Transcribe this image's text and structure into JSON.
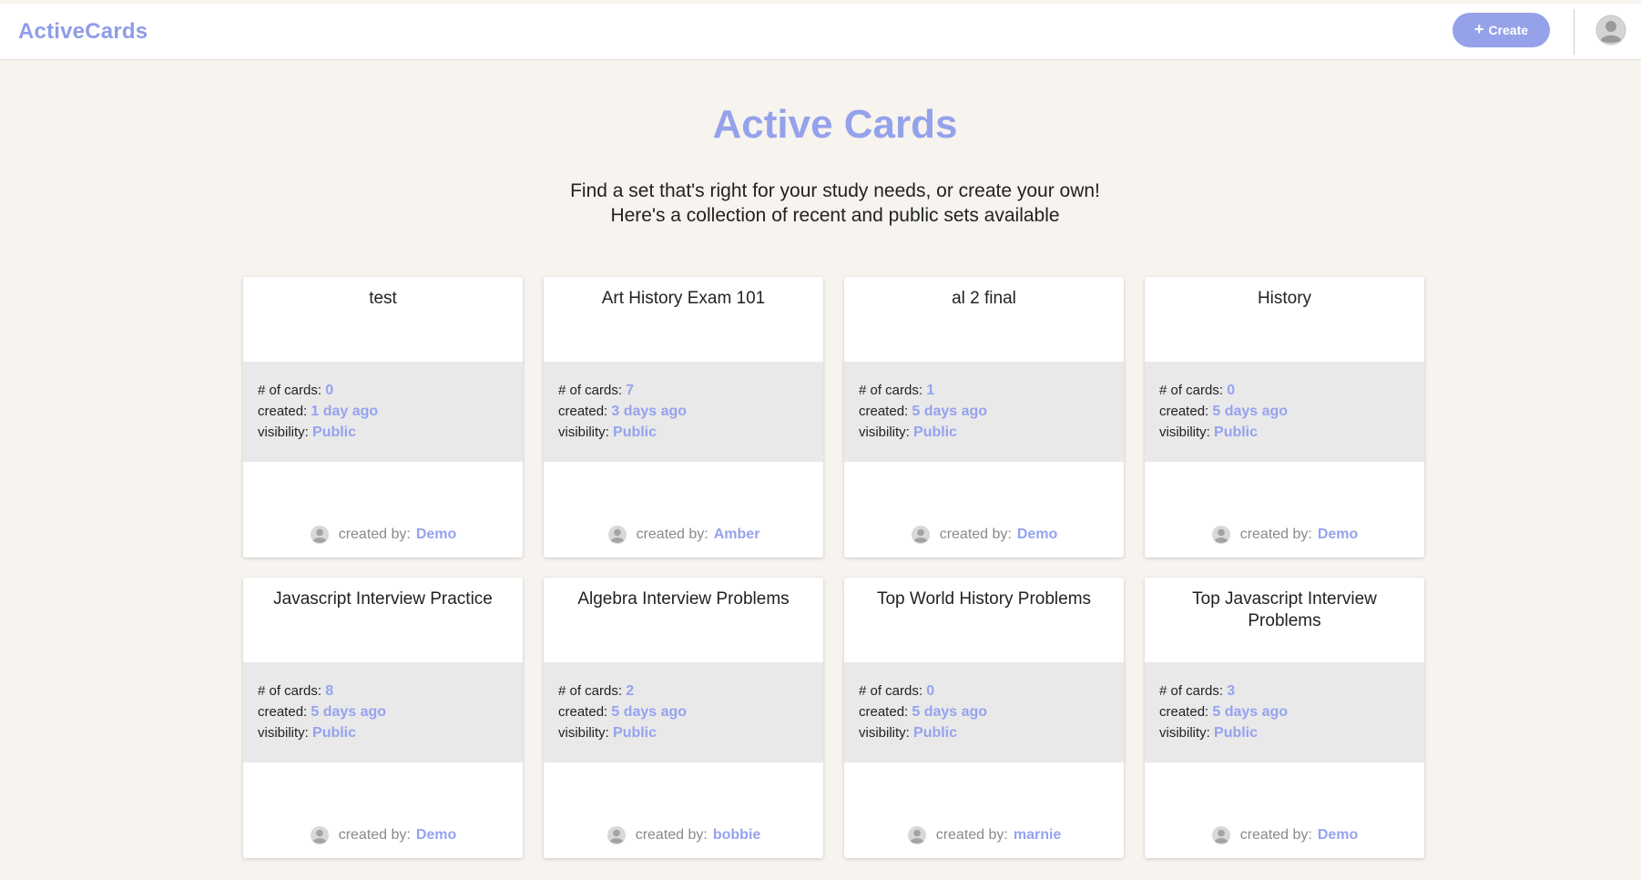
{
  "header": {
    "brand": "ActiveCards",
    "create_label": "Create"
  },
  "hero": {
    "title": "Active Cards",
    "subtitle_line1": "Find a set that's right for your study needs, or create your own!",
    "subtitle_line2": "Here's a collection of recent and public sets available"
  },
  "labels": {
    "cards": "# of cards:",
    "created": "created:",
    "visibility": "visibility:",
    "created_by": "created by:"
  },
  "cards": [
    {
      "title": "test",
      "count": "0",
      "created": "1 day ago",
      "visibility": "Public",
      "creator": "Demo"
    },
    {
      "title": "Art History Exam 101",
      "count": "7",
      "created": "3 days ago",
      "visibility": "Public",
      "creator": "Amber"
    },
    {
      "title": "al 2 final",
      "count": "1",
      "created": "5 days ago",
      "visibility": "Public",
      "creator": "Demo"
    },
    {
      "title": "History",
      "count": "0",
      "created": "5 days ago",
      "visibility": "Public",
      "creator": "Demo"
    },
    {
      "title": "Javascript Interview Practice",
      "count": "8",
      "created": "5 days ago",
      "visibility": "Public",
      "creator": "Demo"
    },
    {
      "title": "Algebra Interview Problems",
      "count": "2",
      "created": "5 days ago",
      "visibility": "Public",
      "creator": "bobbie"
    },
    {
      "title": "Top World History Problems",
      "count": "0",
      "created": "5 days ago",
      "visibility": "Public",
      "creator": "marnie"
    },
    {
      "title": "Top Javascript Interview Problems",
      "count": "3",
      "created": "5 days ago",
      "visibility": "Public",
      "creator": "Demo"
    }
  ],
  "colors": {
    "accent": "#95a3ee",
    "background": "#f7f3ee",
    "info_band": "#e9e9ea"
  },
  "icons": {
    "create": "plus-icon",
    "profile": "user-avatar-icon",
    "creator": "user-circle-icon"
  }
}
